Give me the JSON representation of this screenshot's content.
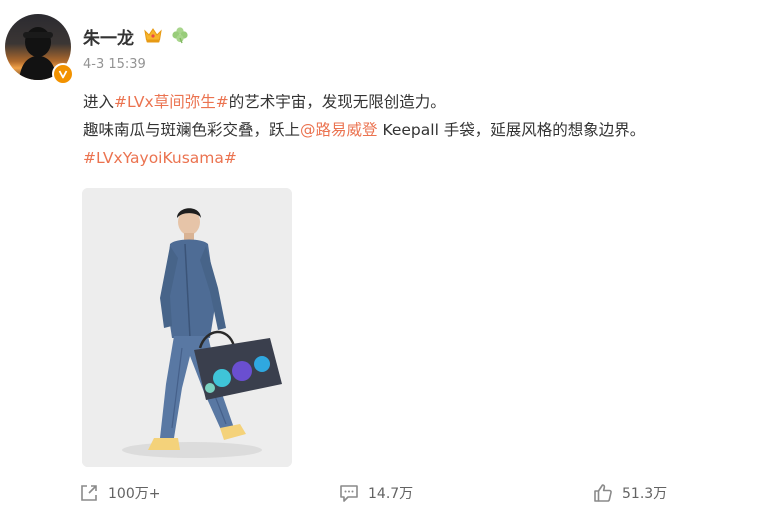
{
  "post": {
    "author": {
      "name": "朱一龙",
      "avatar_icon": "avatar-photo",
      "badges": [
        "crown-icon",
        "clover-icon",
        "verified-icon"
      ]
    },
    "timestamp": "4-3 15:39",
    "text": {
      "line1_prefix": "进入",
      "line1_topic": "#LVx草间弥生#",
      "line1_suffix": "的艺术宇宙，发现无限创造力。",
      "line2_prefix": "趣味南瓜与斑斓色彩交叠，跃上",
      "line2_mention": "@路易威登",
      "line2_suffix": " Keepall 手袋，延展风格的想象边界。",
      "line3_topic": "#LVxYayoiKusama#"
    },
    "media": {
      "alt_icon": "photo-man-in-denim-with-bag"
    },
    "actions": {
      "repost": {
        "icon": "share-icon",
        "count": "100万+"
      },
      "comment": {
        "icon": "comment-icon",
        "count": "14.7万"
      },
      "like": {
        "icon": "thumbs-up-icon",
        "count": "51.3万"
      }
    }
  },
  "colors": {
    "link": "#eb7350",
    "badge": "#f29200",
    "meta": "#939393",
    "text": "#333333"
  }
}
